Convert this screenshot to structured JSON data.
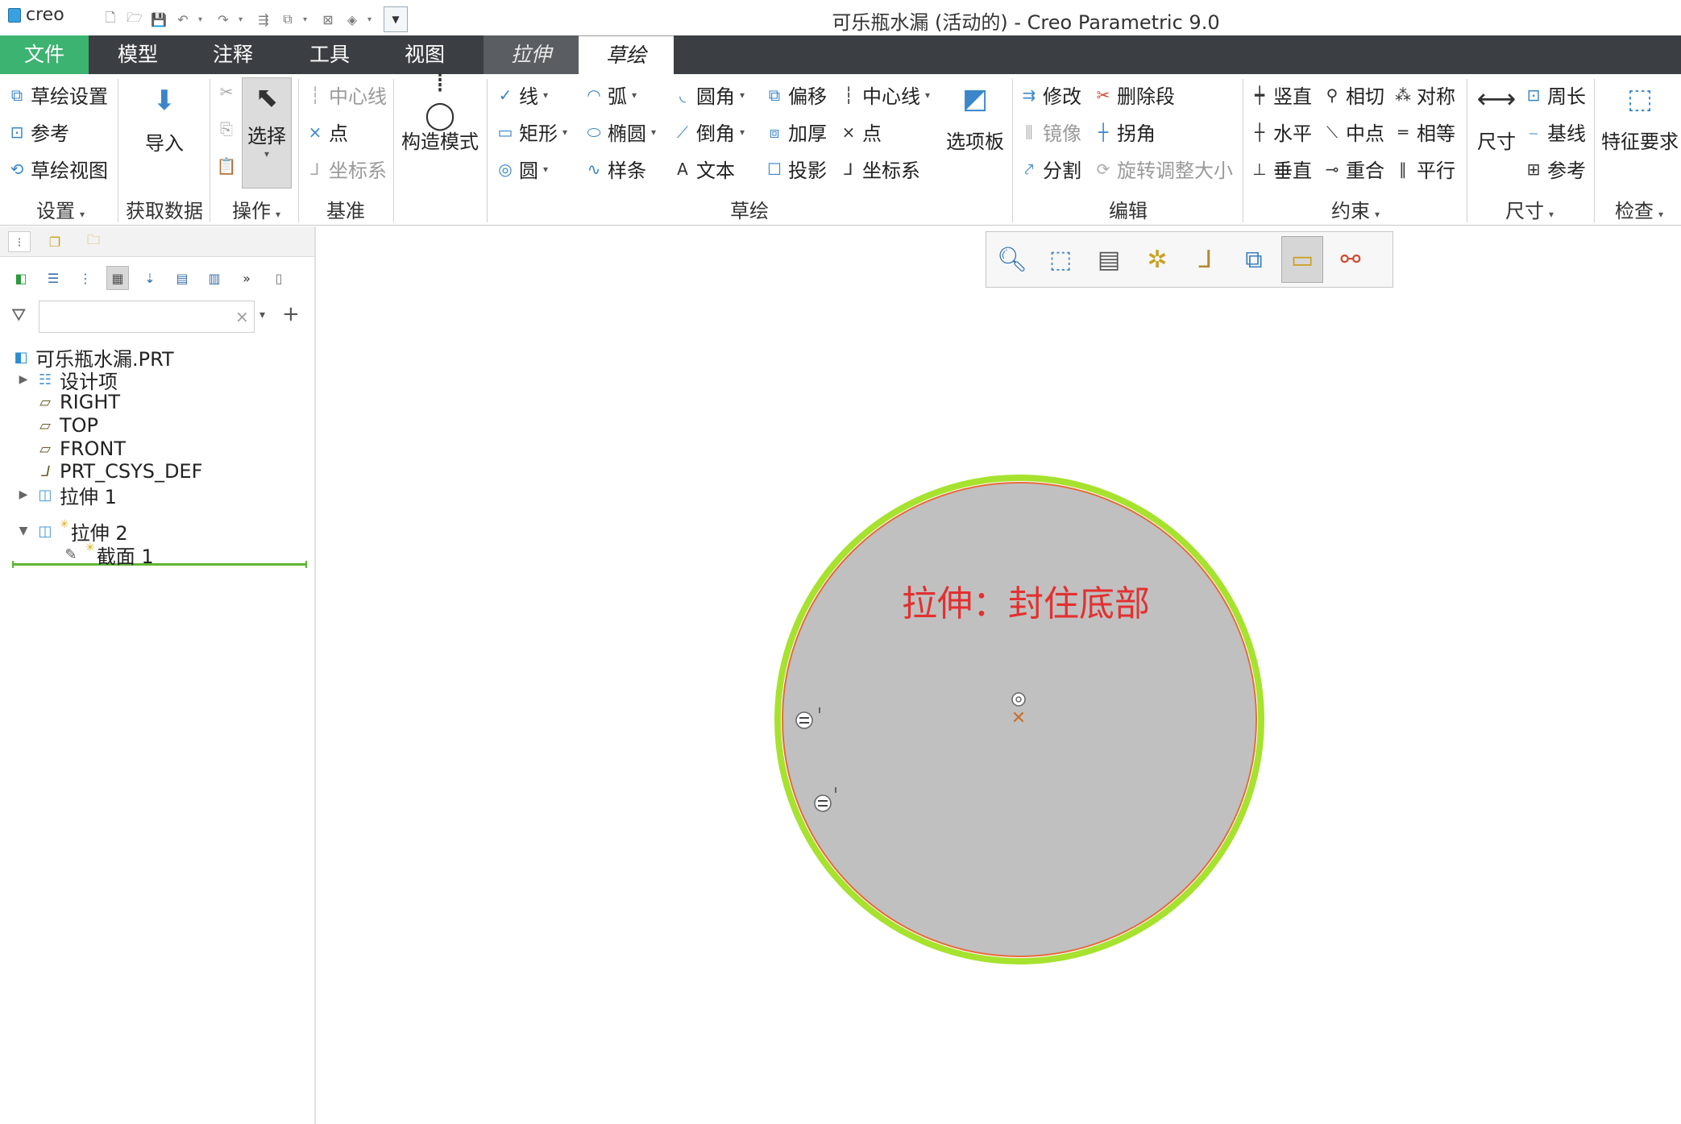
{
  "app": {
    "logo_text": "creo",
    "window_title": "可乐瓶水漏 (活动的) - Creo Parametric 9.0"
  },
  "tabs": [
    {
      "label": "文件"
    },
    {
      "label": "模型"
    },
    {
      "label": "注释"
    },
    {
      "label": "工具"
    },
    {
      "label": "视图"
    },
    {
      "label": "拉伸"
    },
    {
      "label": "草绘"
    }
  ],
  "ribbon": {
    "setup": {
      "sketch_setup": "草绘设置",
      "reference": "参考",
      "sketch_view": "草绘视图",
      "group": "设置"
    },
    "get_data": {
      "import": "导入",
      "group": "获取数据"
    },
    "operations": {
      "select": "选择",
      "group": "操作"
    },
    "datum": {
      "centerline": "中心线",
      "point": "点",
      "csys": "坐标系",
      "group": "基准"
    },
    "construction": {
      "mode": "构造模式"
    },
    "sketching": {
      "line": "线",
      "rectangle": "矩形",
      "circle": "圆",
      "arc": "弧",
      "ellipse": "椭圆",
      "spline": "样条",
      "fillet": "圆角",
      "chamfer": "倒角",
      "text": "文本",
      "offset": "偏移",
      "thicken": "加厚",
      "project": "投影",
      "centerline": "中心线",
      "point": "点",
      "csys": "坐标系",
      "palette": "选项板",
      "group": "草绘"
    },
    "editing": {
      "modify": "修改",
      "delete_segment": "删除段",
      "mirror": "镜像",
      "corner": "拐角",
      "divide": "分割",
      "rotate_resize": "旋转调整大小",
      "group": "编辑"
    },
    "constrain": {
      "vertical": "竖直",
      "tangent": "相切",
      "symmetric": "对称",
      "horizontal": "水平",
      "midpoint": "中点",
      "equal": "相等",
      "perpendicular": "垂直",
      "coincident": "重合",
      "parallel": "平行",
      "group": "约束"
    },
    "dimension": {
      "dimension": "尺寸",
      "perimeter": "周长",
      "baseline": "基线",
      "reference": "参考",
      "group": "尺寸"
    },
    "inspect": {
      "feature_requirements": "特征要求",
      "group": "检查"
    }
  },
  "model_tree": {
    "search_placeholder": "",
    "items": [
      {
        "label": "可乐瓶水漏.PRT",
        "icon": "part-icon"
      },
      {
        "label": "设计项",
        "icon": "design-items-icon"
      },
      {
        "label": "RIGHT",
        "icon": "datum-plane-icon"
      },
      {
        "label": "TOP",
        "icon": "datum-plane-icon"
      },
      {
        "label": "FRONT",
        "icon": "datum-plane-icon"
      },
      {
        "label": "PRT_CSYS_DEF",
        "icon": "csys-icon"
      },
      {
        "label": "拉伸 1",
        "icon": "extrude-icon"
      },
      {
        "label": "拉伸 2",
        "icon": "extrude-icon"
      },
      {
        "label": "截面 1",
        "icon": "section-icon"
      }
    ]
  },
  "graphics": {
    "annotation": "拉伸：封住底部",
    "fill_color": "#c0c0c0",
    "outline_color": "#a6e22e",
    "annotation_color": "#e33030"
  }
}
